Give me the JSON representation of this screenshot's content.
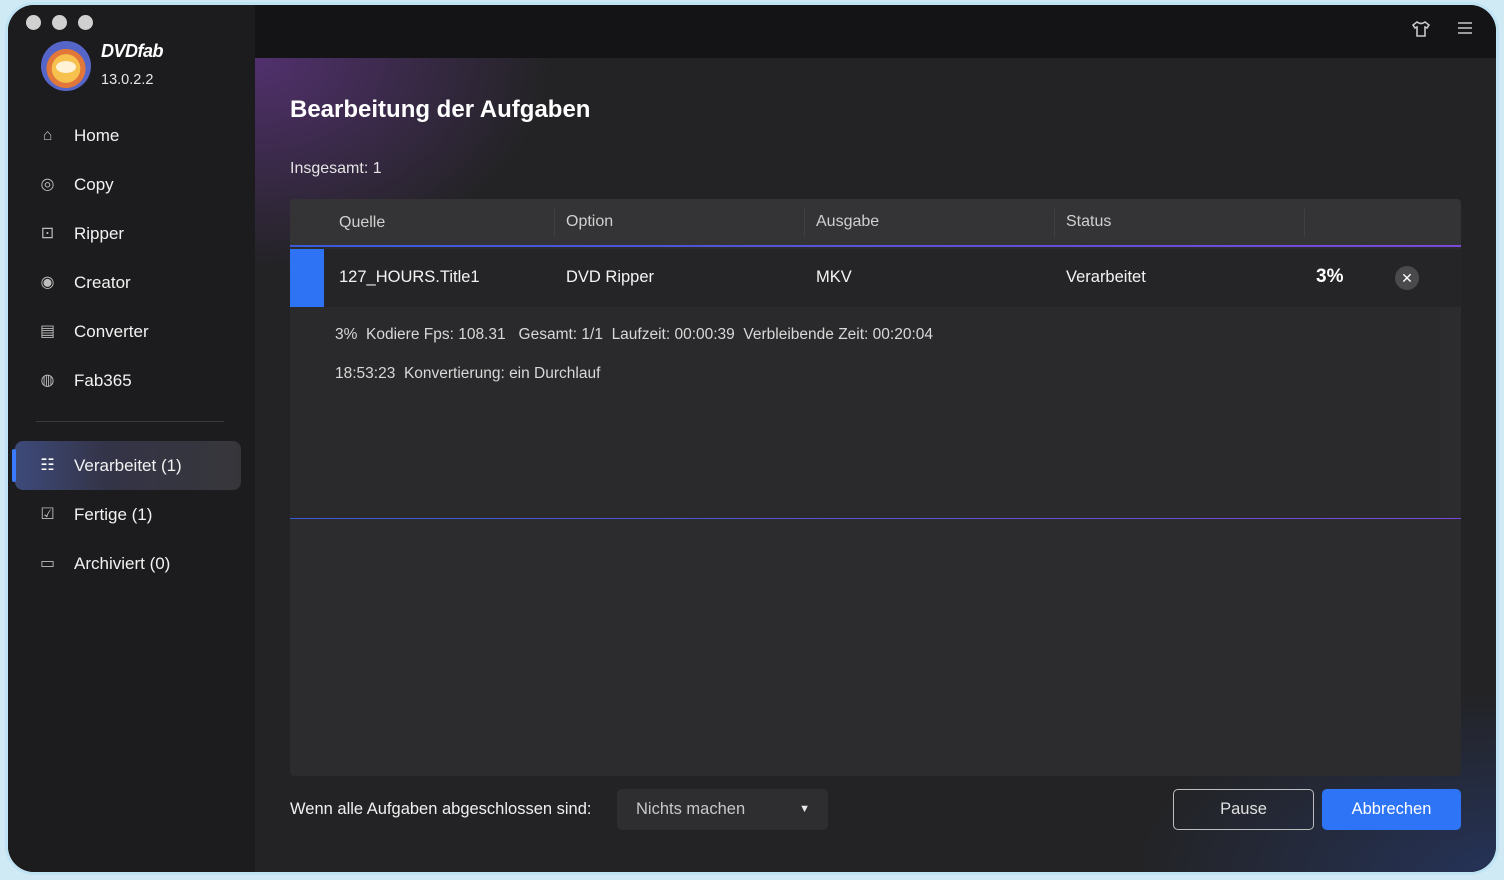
{
  "app": {
    "brand": "DVDfab",
    "version": "13.0.2.2"
  },
  "sidebar": {
    "items": [
      {
        "label": "Home",
        "icon": "home-icon"
      },
      {
        "label": "Copy",
        "icon": "copy-icon"
      },
      {
        "label": "Ripper",
        "icon": "ripper-icon"
      },
      {
        "label": "Creator",
        "icon": "creator-icon"
      },
      {
        "label": "Converter",
        "icon": "converter-icon"
      },
      {
        "label": "Fab365",
        "icon": "fab365-icon"
      }
    ],
    "queue": [
      {
        "label": "Verarbeitet (1)",
        "icon": "processing-list-icon",
        "active": true
      },
      {
        "label": "Fertige (1)",
        "icon": "finished-icon",
        "active": false
      },
      {
        "label": "Archiviert (0)",
        "icon": "archive-icon",
        "active": false
      }
    ]
  },
  "topbar": {
    "icons": [
      "shirt-icon",
      "menu-icon"
    ]
  },
  "main": {
    "title": "Bearbeitung der Aufgaben",
    "total": "Insgesamt: 1",
    "columns": [
      "Quelle",
      "Option",
      "Ausgabe",
      "Status"
    ],
    "task": {
      "source": "127_HOURS.Title1",
      "option": "DVD Ripper",
      "output": "MKV",
      "status": "Verarbeitet",
      "percent": "3%",
      "close": "✕"
    },
    "details": {
      "line1": "3%  Kodiere Fps: 108.31   Gesamt: 1/1  Laufzeit: 00:00:39  Verbleibende Zeit: 00:20:04",
      "line2": "18:53:23  Konvertierung: ein Durchlauf"
    }
  },
  "footer": {
    "label": "Wenn alle Aufgaben abgeschlossen sind:",
    "select_value": "Nichts machen",
    "pause_label": "Pause",
    "cancel_label": "Abbrechen"
  },
  "colors": {
    "accent": "#2f73f5",
    "sidebar_bg": "#1c1c1e",
    "main_bg": "#232325"
  }
}
